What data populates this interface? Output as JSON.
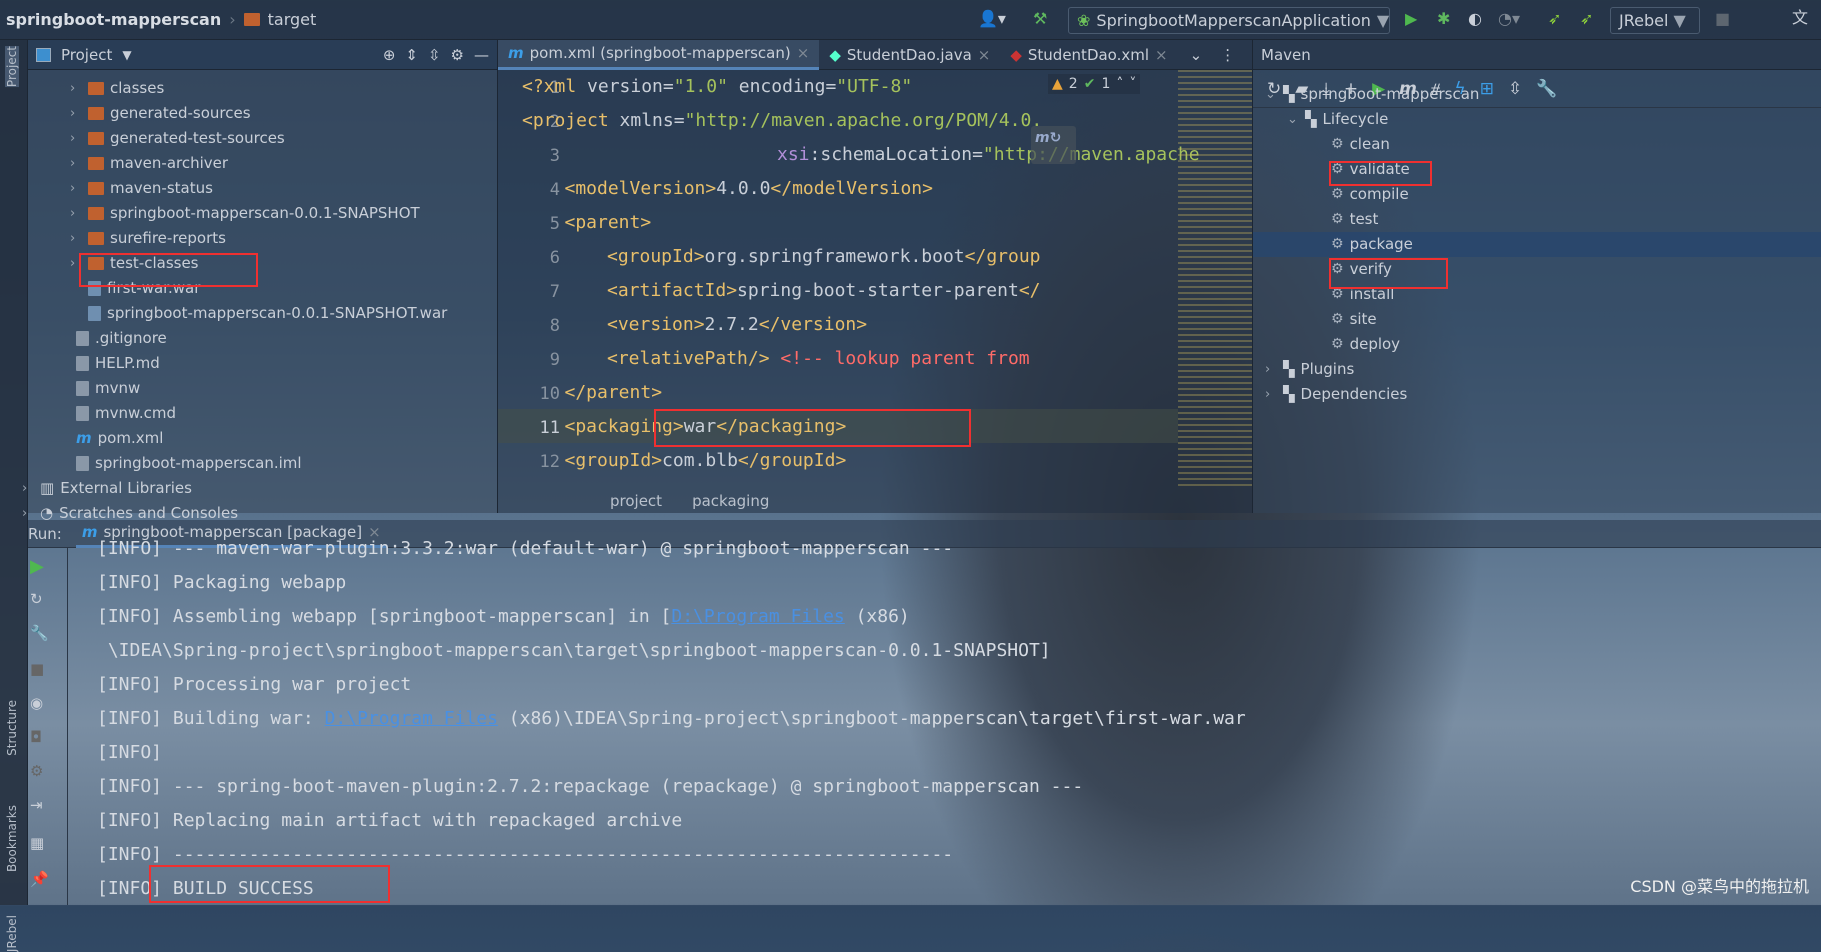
{
  "breadcrumb": {
    "project": "springboot-mapperscan",
    "folder": "target"
  },
  "toolbar": {
    "run_config": "SpringbootMapperscanApplication",
    "jrebel": "JRebel"
  },
  "left_stripe": {
    "project": "Project",
    "structure": "Structure",
    "bookmarks": "Bookmarks",
    "jrebel": "JRebel"
  },
  "project_panel": {
    "title": "Project",
    "items": [
      {
        "label": "classes",
        "type": "folder",
        "expand": true
      },
      {
        "label": "generated-sources",
        "type": "folder",
        "expand": true
      },
      {
        "label": "generated-test-sources",
        "type": "folder",
        "expand": true
      },
      {
        "label": "maven-archiver",
        "type": "folder",
        "expand": true
      },
      {
        "label": "maven-status",
        "type": "folder",
        "expand": true
      },
      {
        "label": "springboot-mapperscan-0.0.1-SNAPSHOT",
        "type": "folder",
        "expand": true
      },
      {
        "label": "surefire-reports",
        "type": "folder",
        "expand": true
      },
      {
        "label": "test-classes",
        "type": "folder",
        "expand": true
      },
      {
        "label": "first-war.war",
        "type": "war"
      },
      {
        "label": "springboot-mapperscan-0.0.1-SNAPSHOT.war",
        "type": "war"
      },
      {
        "label": ".gitignore",
        "type": "file"
      },
      {
        "label": "HELP.md",
        "type": "file"
      },
      {
        "label": "mvnw",
        "type": "file"
      },
      {
        "label": "mvnw.cmd",
        "type": "file"
      },
      {
        "label": "pom.xml",
        "type": "maven"
      },
      {
        "label": "springboot-mapperscan.iml",
        "type": "file"
      },
      {
        "label": "External Libraries",
        "type": "lib"
      },
      {
        "label": "Scratches and Consoles",
        "type": "scratch"
      }
    ]
  },
  "editor": {
    "tabs": [
      {
        "label": "pom.xml (springboot-mapperscan)",
        "active": true
      },
      {
        "label": "StudentDao.java"
      },
      {
        "label": "StudentDao.xml"
      }
    ],
    "inspections": {
      "warnings": "2",
      "ok": "1"
    },
    "lines": [
      {
        "n": "1",
        "indent": 0,
        "parts": [
          [
            "tg",
            "<?xml "
          ],
          [
            "at",
            "version="
          ],
          [
            "str",
            "\"1.0\""
          ],
          [
            "at",
            " encoding="
          ],
          [
            "str",
            "\"UTF-8\""
          ]
        ]
      },
      {
        "n": "2",
        "indent": 0,
        "parts": [
          [
            "tg",
            "<project "
          ],
          [
            "at",
            "xmlns="
          ],
          [
            "str",
            "\"http://maven.apache.org/POM/4.0."
          ]
        ]
      },
      {
        "n": "3",
        "indent": 6,
        "parts": [
          [
            "ns",
            "xsi"
          ],
          [
            "at",
            ":schemaLocation="
          ],
          [
            "str",
            "\"http://maven.apache"
          ]
        ]
      },
      {
        "n": "4",
        "indent": 1,
        "parts": [
          [
            "tg",
            "<modelVersion>"
          ],
          [
            "at",
            "4.0.0"
          ],
          [
            "tg",
            "</modelVersion>"
          ]
        ]
      },
      {
        "n": "5",
        "indent": 1,
        "parts": [
          [
            "tg",
            "<parent>"
          ]
        ]
      },
      {
        "n": "6",
        "indent": 2,
        "parts": [
          [
            "tg",
            "<groupId>"
          ],
          [
            "at",
            "org.springframework.boot"
          ],
          [
            "tg",
            "</group"
          ]
        ]
      },
      {
        "n": "7",
        "indent": 2,
        "parts": [
          [
            "tg",
            "<artifactId>"
          ],
          [
            "at",
            "spring-boot-starter-parent"
          ],
          [
            "tg",
            "</"
          ]
        ]
      },
      {
        "n": "8",
        "indent": 2,
        "parts": [
          [
            "tg",
            "<version>"
          ],
          [
            "at",
            "2.7.2"
          ],
          [
            "tg",
            "</version>"
          ]
        ]
      },
      {
        "n": "9",
        "indent": 2,
        "parts": [
          [
            "tg",
            "<relativePath/> "
          ],
          [
            "cm",
            "<!-- lookup parent from"
          ]
        ]
      },
      {
        "n": "10",
        "indent": 1,
        "parts": [
          [
            "tg",
            "</parent>"
          ]
        ]
      },
      {
        "n": "11",
        "indent": 1,
        "parts": [
          [
            "tg",
            "<packaging>"
          ],
          [
            "at",
            "war"
          ],
          [
            "tg",
            "</packaging>"
          ]
        ]
      },
      {
        "n": "12",
        "indent": 1,
        "parts": [
          [
            "tg",
            "<groupId>"
          ],
          [
            "at",
            "com.blb"
          ],
          [
            "tg",
            "</groupId>"
          ]
        ]
      }
    ],
    "breadcrumbs": [
      "project",
      "packaging"
    ]
  },
  "maven": {
    "title": "Maven",
    "root": "springboot-mapperscan",
    "lifecycle": "Lifecycle",
    "goals": [
      "clean",
      "validate",
      "compile",
      "test",
      "package",
      "verify",
      "install",
      "site",
      "deploy"
    ],
    "selected": "package",
    "plugins": "Plugins",
    "dependencies": "Dependencies"
  },
  "run": {
    "label": "Run:",
    "tab": "springboot-mapperscan [package]"
  },
  "console": [
    "[INFO] --- maven-war-plugin:3.3.2:war (default-war) @ springboot-mapperscan ---",
    "[INFO] Packaging webapp",
    [
      "[INFO] Assembling webapp [springboot-mapperscan] in [",
      "D:\\Program Files",
      " (x86)"
    ],
    " \\IDEA\\Spring-project\\springboot-mapperscan\\target\\springboot-mapperscan-0.0.1-SNAPSHOT]",
    "[INFO] Processing war project",
    [
      "[INFO] Building war: ",
      "D:\\Program Files",
      " (x86)\\IDEA\\Spring-project\\springboot-mapperscan\\target\\first-war.war"
    ],
    "[INFO]",
    "[INFO] --- spring-boot-maven-plugin:2.7.2:repackage (repackage) @ springboot-mapperscan ---",
    "[INFO] Replacing main artifact with repackaged archive",
    "[INFO] ------------------------------------------------------------------------",
    "[INFO] BUILD SUCCESS"
  ],
  "watermark": "CSDN @菜鸟中的拖拉机",
  "colors": {
    "highlight_box": "#f03030",
    "link": "#4a90e2",
    "tag": "#e8bf6a",
    "string": "#a5c25c",
    "comment": "#ff6b68"
  }
}
